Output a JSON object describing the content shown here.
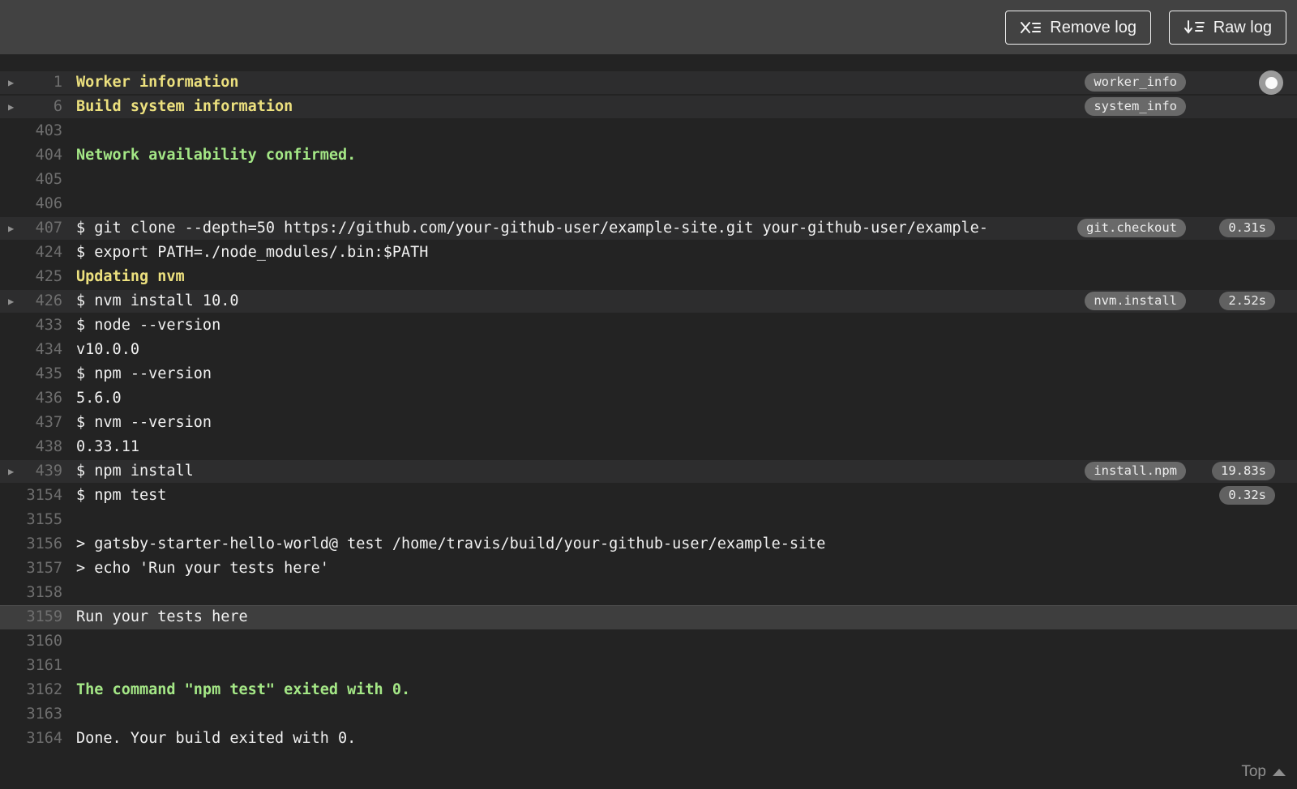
{
  "header": {
    "buttons": [
      {
        "id": "remove-log",
        "label": "Remove log",
        "icon": "remove-log-icon"
      },
      {
        "id": "raw-log",
        "label": "Raw log",
        "icon": "raw-log-icon"
      }
    ]
  },
  "log": {
    "lines": [
      {
        "number": "1",
        "text": "Worker information",
        "color": "yellow",
        "fold": true,
        "badge": "worker_info",
        "follow_button": true
      },
      {
        "number": "6",
        "text": "Build system information",
        "color": "yellow",
        "fold": true,
        "badge": "system_info"
      },
      {
        "number": "403",
        "text": ""
      },
      {
        "number": "404",
        "text": "Network availability confirmed.",
        "color": "green"
      },
      {
        "number": "405",
        "text": ""
      },
      {
        "number": "406",
        "text": ""
      },
      {
        "number": "407",
        "text": "$ git clone --depth=50 https://github.com/your-github-user/example-site.git your-github-user/example-",
        "fold": true,
        "badge": "git.checkout",
        "time": "0.31s"
      },
      {
        "number": "424",
        "text": "$ export PATH=./node_modules/.bin:$PATH"
      },
      {
        "number": "425",
        "text": "Updating nvm",
        "color": "yellow"
      },
      {
        "number": "426",
        "text": "$ nvm install 10.0",
        "fold": true,
        "badge": "nvm.install",
        "time": "2.52s"
      },
      {
        "number": "433",
        "text": "$ node --version"
      },
      {
        "number": "434",
        "text": "v10.0.0"
      },
      {
        "number": "435",
        "text": "$ npm --version"
      },
      {
        "number": "436",
        "text": "5.6.0"
      },
      {
        "number": "437",
        "text": "$ nvm --version"
      },
      {
        "number": "438",
        "text": "0.33.11"
      },
      {
        "number": "439",
        "text": "$ npm install",
        "fold": true,
        "badge": "install.npm",
        "time": "19.83s"
      },
      {
        "number": "3154",
        "text": "$ npm test",
        "time": "0.32s"
      },
      {
        "number": "3155",
        "text": ""
      },
      {
        "number": "3156",
        "text": "> gatsby-starter-hello-world@ test /home/travis/build/your-github-user/example-site"
      },
      {
        "number": "3157",
        "text": "> echo 'Run your tests here'"
      },
      {
        "number": "3158",
        "text": ""
      },
      {
        "number": "3159",
        "text": "Run your tests here",
        "highlight": true
      },
      {
        "number": "3160",
        "text": ""
      },
      {
        "number": "3161",
        "text": ""
      },
      {
        "number": "3162",
        "text": "The command \"npm test\" exited with 0.",
        "color": "green"
      },
      {
        "number": "3163",
        "text": ""
      },
      {
        "number": "3164",
        "text": "Done. Your build exited with 0."
      }
    ]
  },
  "footer": {
    "top_label": "Top"
  },
  "colors": {
    "yellow": "#ece07e",
    "green": "#a4e786",
    "badge_bg": "#696969",
    "badge_time_bg": "#616161",
    "header_bg": "#424242",
    "log_bg": "#232323",
    "fold_row_bg": "#2d2d2e",
    "highlight_row_bg": "#3e3e3e"
  }
}
